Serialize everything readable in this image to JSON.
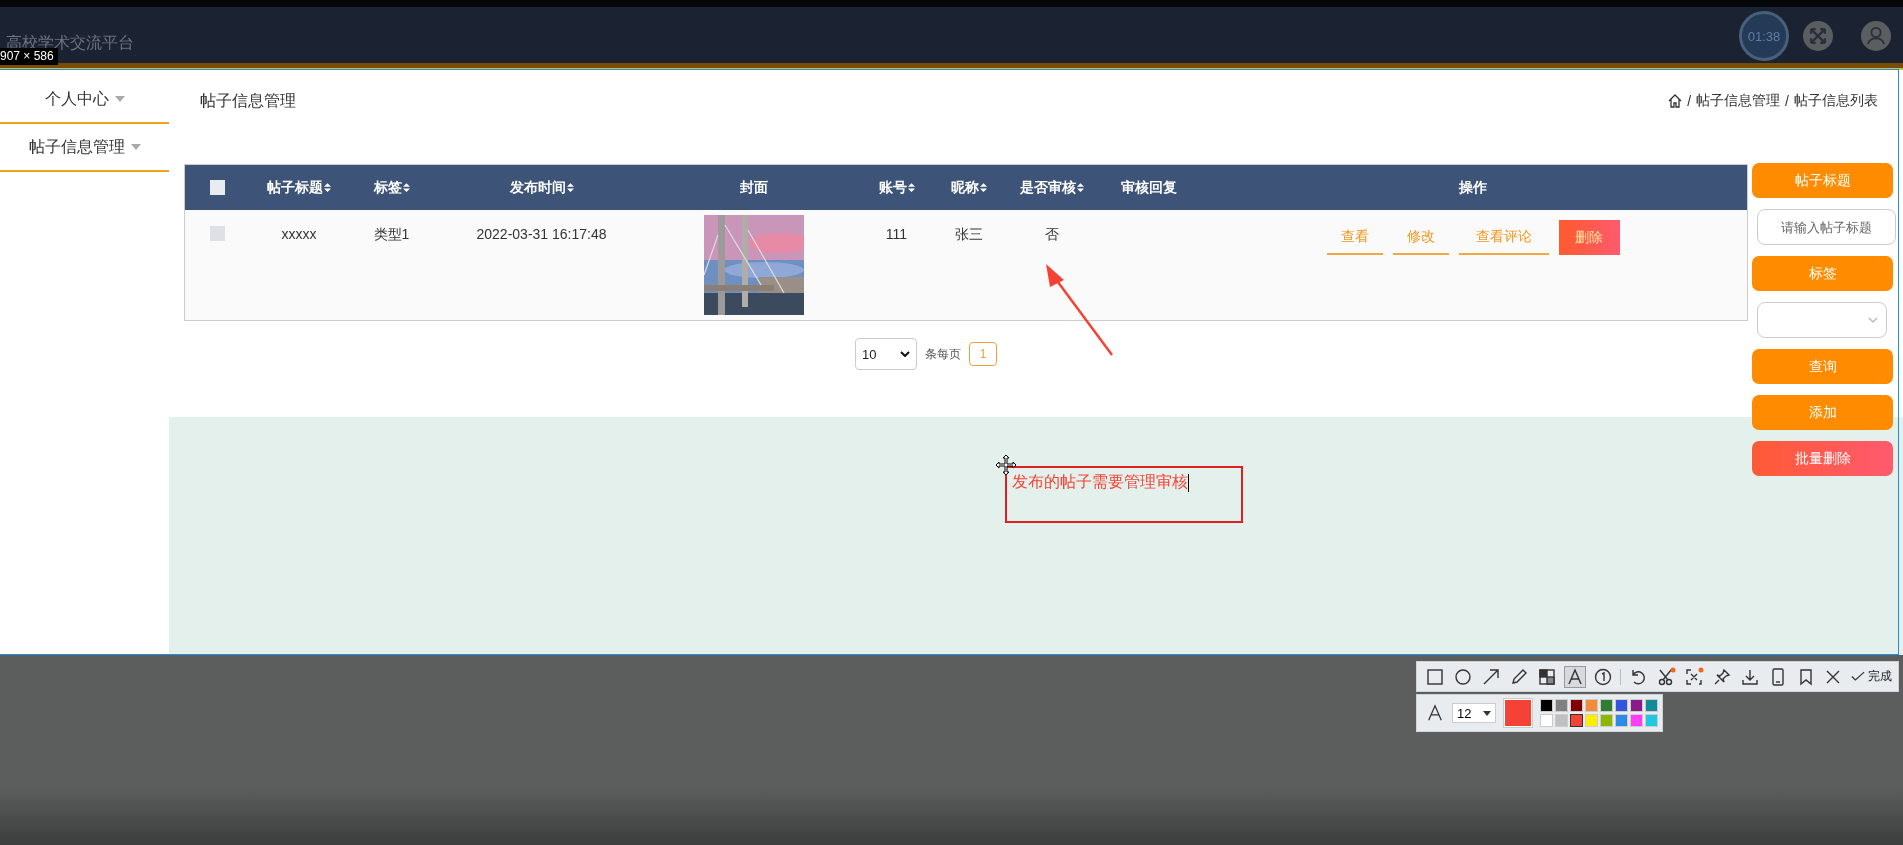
{
  "top_bar": {
    "title": "高校学术交流平台",
    "timer": "01:38"
  },
  "capture_size": "907 × 586",
  "sidebar": {
    "items": [
      {
        "label": "个人中心"
      },
      {
        "label": "帖子信息管理"
      }
    ]
  },
  "page_title": "帖子信息管理",
  "breadcrumb": {
    "items": [
      "帖子信息管理",
      "帖子信息列表"
    ],
    "separator": "/"
  },
  "table": {
    "header_checked": false,
    "columns": [
      {
        "label": "帖子标题",
        "sortable": true
      },
      {
        "label": "标签",
        "sortable": true
      },
      {
        "label": "发布时间",
        "sortable": true
      },
      {
        "label": "封面",
        "sortable": false
      },
      {
        "label": "账号",
        "sortable": true
      },
      {
        "label": "昵称",
        "sortable": true
      },
      {
        "label": "是否审核",
        "sortable": true
      },
      {
        "label": "审核回复",
        "sortable": false
      },
      {
        "label": "操作",
        "sortable": false
      }
    ],
    "rows": [
      {
        "checked": false,
        "title": "xxxxx",
        "tag": "类型1",
        "time": "2022-03-31 16:17:48",
        "account": "111",
        "nickname": "张三",
        "audited": "否",
        "actions": [
          {
            "label": "查看",
            "kind": "link"
          },
          {
            "label": "修改",
            "kind": "link"
          },
          {
            "label": "查看评论",
            "kind": "link"
          },
          {
            "label": "删除",
            "kind": "danger"
          }
        ]
      }
    ]
  },
  "pagination": {
    "page_size": "10",
    "per_page_label": "条每页",
    "pages": [
      {
        "label": "1",
        "selected": true
      }
    ]
  },
  "search_panel": [
    {
      "kind": "label",
      "text": "帖子标题"
    },
    {
      "kind": "input",
      "placeholder": "请输入帖子标题"
    },
    {
      "kind": "label",
      "text": "标签"
    },
    {
      "kind": "select"
    },
    {
      "kind": "button",
      "text": "查询"
    },
    {
      "kind": "button",
      "text": "添加"
    },
    {
      "kind": "danger",
      "text": "批量删除"
    }
  ],
  "annotation": {
    "text": "发布的帖子需要管理审核"
  },
  "capture_toolbar": {
    "tools": [
      {
        "kind": "rectangle",
        "selected": false
      },
      {
        "kind": "ellipse",
        "selected": false
      },
      {
        "kind": "arrow",
        "selected": false
      },
      {
        "kind": "pencil",
        "selected": false
      },
      {
        "kind": "mosaic",
        "selected": false
      },
      {
        "kind": "text",
        "selected": true
      },
      {
        "kind": "number",
        "selected": false
      },
      {
        "kind": "undo",
        "selected": false
      },
      {
        "kind": "scissors",
        "selected": false
      },
      {
        "kind": "capture",
        "selected": false
      },
      {
        "kind": "pin",
        "selected": false
      },
      {
        "kind": "download",
        "selected": false
      },
      {
        "kind": "phone",
        "selected": false
      },
      {
        "kind": "bookmark",
        "selected": false
      }
    ],
    "done_label": "完成",
    "font_size": "12",
    "current_swatch": {
      "color": "#f44336"
    },
    "palette": [
      {
        "color": "#000000",
        "selected": false
      },
      {
        "color": "#808080",
        "selected": false
      },
      {
        "color": "#800000",
        "selected": false
      },
      {
        "color": "#f28c38",
        "selected": false
      },
      {
        "color": "#2e7d32",
        "selected": false
      },
      {
        "color": "#3355dd",
        "selected": false
      },
      {
        "color": "#8b1a8b",
        "selected": false
      },
      {
        "color": "#138a99",
        "selected": false
      },
      {
        "color": "#ffffff",
        "selected": false
      },
      {
        "color": "#c0c0c0",
        "selected": false
      },
      {
        "color": "#f44336",
        "selected": true
      },
      {
        "color": "#ffee00",
        "selected": false
      },
      {
        "color": "#8db600",
        "selected": false
      },
      {
        "color": "#2b8be6",
        "selected": false
      },
      {
        "color": "#ff3df5",
        "selected": false
      },
      {
        "color": "#1ec8e0",
        "selected": false
      }
    ]
  }
}
